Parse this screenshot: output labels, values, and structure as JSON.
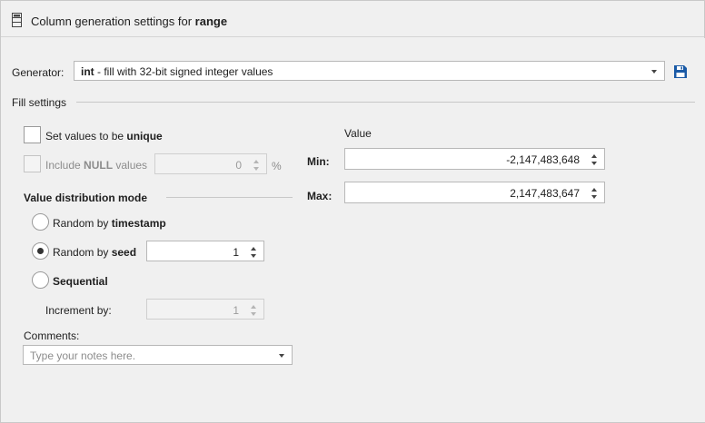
{
  "header": {
    "title_prefix": "Column generation settings for ",
    "title_column": "range"
  },
  "generator": {
    "label": "Generator:",
    "selected_keyword": "int",
    "selected_description": " - fill with 32-bit signed integer values"
  },
  "fill_settings": {
    "legend": "Fill settings",
    "unique": {
      "prefix": "Set values to be ",
      "emph": "unique",
      "checked": false
    },
    "include_null": {
      "prefix": "Include ",
      "emph": "NULL",
      "suffix": " values",
      "value": "0",
      "unit": "%",
      "checked": false,
      "enabled": false
    }
  },
  "distribution": {
    "legend": "Value distribution mode",
    "random_timestamp": {
      "prefix": "Random by ",
      "emph": "timestamp",
      "selected": false
    },
    "random_seed": {
      "prefix": "Random by ",
      "emph": "seed",
      "selected": true,
      "value": "1"
    },
    "sequential": {
      "label": "Sequential",
      "selected": false
    },
    "increment": {
      "label": "Increment by:",
      "value": "1",
      "enabled": false
    }
  },
  "comments": {
    "label": "Comments:",
    "placeholder": "Type your notes here."
  },
  "value_range": {
    "heading": "Value",
    "min_label": "Min:",
    "min_value": "-2,147,483,648",
    "max_label": "Max:",
    "max_value": "2,147,483,647"
  },
  "colors": {
    "save_icon": "#1a5aa6"
  }
}
